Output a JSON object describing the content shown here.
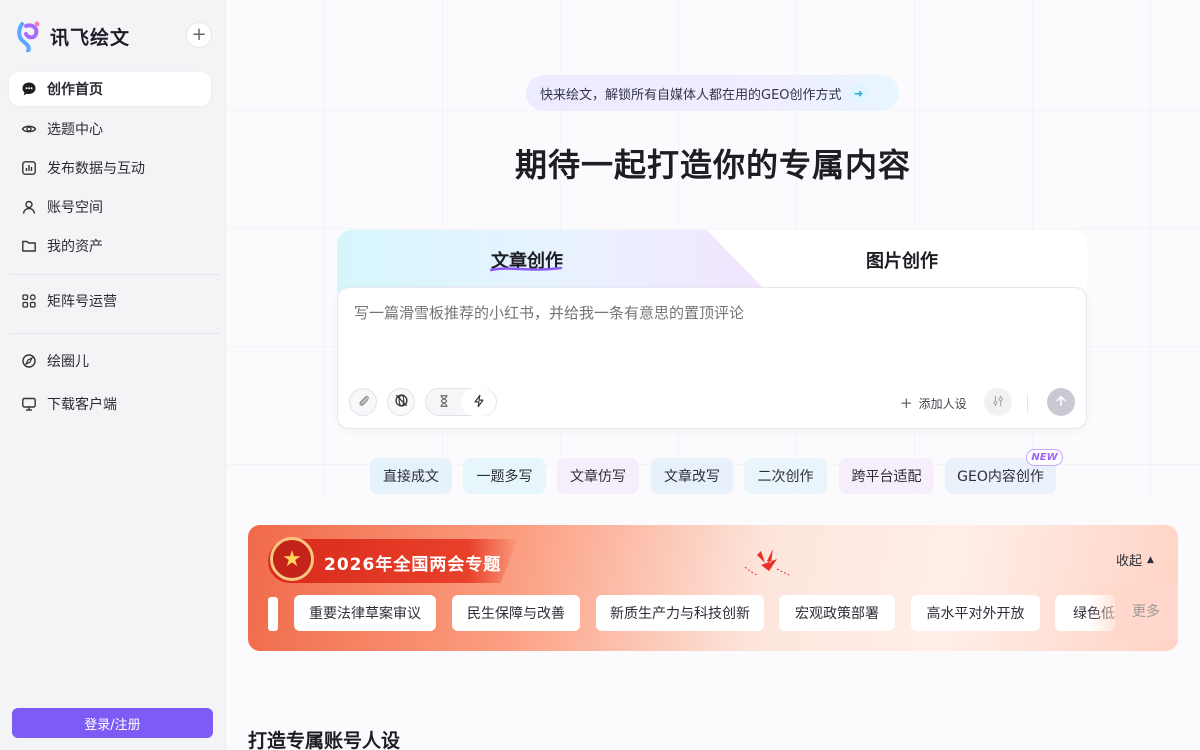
{
  "brand": {
    "name": "讯飞绘文"
  },
  "sidebar": {
    "items": [
      {
        "label": "创作首页",
        "icon": "chat-bubble-icon",
        "active": true
      },
      {
        "label": "选题中心",
        "icon": "eye-icon"
      },
      {
        "label": "发布数据与互动",
        "icon": "bar-chart-icon"
      },
      {
        "label": "账号空间",
        "icon": "user-icon"
      },
      {
        "label": "我的资产",
        "icon": "folder-icon"
      },
      {
        "label": "矩阵号运营",
        "icon": "grid-apps-icon"
      },
      {
        "label": "绘圈儿",
        "icon": "compass-icon"
      },
      {
        "label": "下载客户端",
        "icon": "monitor-icon"
      }
    ],
    "login_label": "登录/注册"
  },
  "promo": {
    "text": "快来绘文，解锁所有自媒体人都在用的GEO创作方式"
  },
  "hero": {
    "title": "期待一起打造你的专属内容"
  },
  "tabs": [
    {
      "label": "文章创作",
      "active": true
    },
    {
      "label": "图片创作"
    }
  ],
  "composer": {
    "placeholder": "写一篇滑雪板推荐的小红书，并给我一条有意思的置顶评论",
    "add_persona_label": "添加人设"
  },
  "chips": [
    {
      "label": "直接成文",
      "color": "#e5f1fb"
    },
    {
      "label": "一题多写",
      "color": "#e6f6fb"
    },
    {
      "label": "文章仿写",
      "color": "#f6eefb"
    },
    {
      "label": "文章改写",
      "color": "#e7f1fb"
    },
    {
      "label": "二次创作",
      "color": "#eaf5fb"
    },
    {
      "label": "跨平台适配",
      "color": "#f6eefb"
    },
    {
      "label": "GEO内容创作",
      "color": "#eaf1fb"
    }
  ],
  "new_badge": "NEW",
  "banner": {
    "title": "2026年全国两会专题",
    "collapse_label": "收起",
    "more_label": "更多",
    "topics": [
      "重要法律草案审议",
      "民生保障与改善",
      "新质生产力与科技创新",
      "宏观政策部署",
      "高水平对外开放",
      "绿色低"
    ]
  },
  "section": {
    "title": "打造专属账号人设"
  }
}
